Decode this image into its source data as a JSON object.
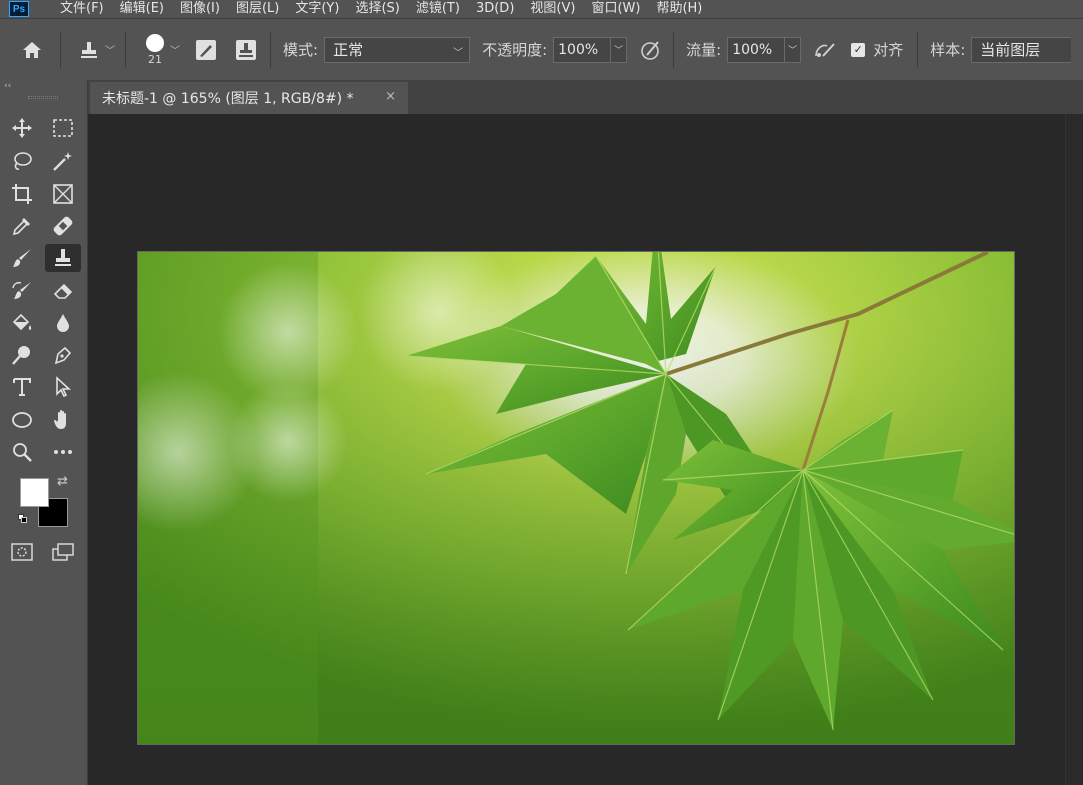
{
  "app": {
    "logo_text": "Ps",
    "accent": "#31a8ff"
  },
  "menu": [
    "文件(F)",
    "编辑(E)",
    "图像(I)",
    "图层(L)",
    "文字(Y)",
    "选择(S)",
    "滤镜(T)",
    "3D(D)",
    "视图(V)",
    "窗口(W)",
    "帮助(H)"
  ],
  "options": {
    "brush_size": "21",
    "mode_label": "模式:",
    "mode_value": "正常",
    "opacity_label": "不透明度:",
    "opacity_value": "100%",
    "flow_label": "流量:",
    "flow_value": "100%",
    "aligned_label": "对齐",
    "aligned_checked": true,
    "sample_label": "样本:",
    "sample_value": "当前图层"
  },
  "document": {
    "tab_title": "未标题-1 @ 165% (图层 1, RGB/8#) *",
    "close_glyph": "×"
  },
  "colors": {
    "foreground": "#ffffff",
    "background": "#000000"
  },
  "toolbar_icons": [
    "move-icon",
    "rect-marquee-icon",
    "lasso-icon",
    "magic-wand-icon",
    "crop-icon",
    "frame-icon",
    "eyedropper-icon",
    "healing-brush-icon",
    "brush-icon",
    "clone-stamp-icon",
    "history-brush-icon",
    "eraser-icon",
    "paint-bucket-icon",
    "blur-icon",
    "dodge-icon",
    "pen-icon",
    "type-icon",
    "path-select-icon",
    "ellipse-icon",
    "hand-icon",
    "zoom-icon",
    "more-tools-icon",
    "quick-mask-icon",
    "screen-mode-icon"
  ]
}
